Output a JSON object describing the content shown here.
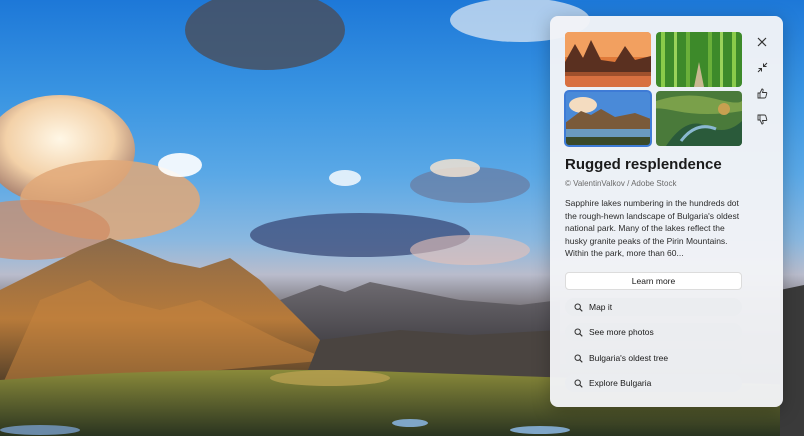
{
  "panel": {
    "title": "Rugged resplendence",
    "credit": "© ValentinValkov / Adobe Stock",
    "description": "Sapphire lakes numbering in the hundreds dot the rough-hewn landscape of Bulgaria's oldest national park. Many of the lakes reflect the husky granite peaks of the Pirin Mountains. Within the park, more than 60...",
    "learn_more": "Learn more",
    "suggestions": [
      {
        "label": "Map it",
        "icon": "search-icon"
      },
      {
        "label": "See more photos",
        "icon": "search-icon"
      },
      {
        "label": "Bulgaria's oldest tree",
        "icon": "search-icon"
      },
      {
        "label": "Explore Bulgaria",
        "icon": "search-icon"
      }
    ],
    "actions": [
      {
        "name": "close",
        "icon": "close-icon"
      },
      {
        "name": "minimize",
        "icon": "collapse-icon"
      },
      {
        "name": "like",
        "icon": "thumbs-up-icon"
      },
      {
        "name": "dislike",
        "icon": "thumbs-down-icon"
      }
    ],
    "selected_thumbnail": 3
  },
  "colors": {
    "accent": "#3e7bd6",
    "panel_bg": "#f3f4f7"
  }
}
